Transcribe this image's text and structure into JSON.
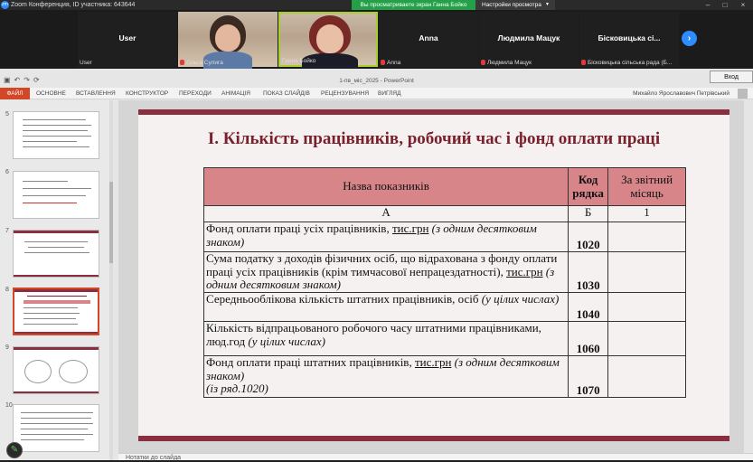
{
  "zoom": {
    "title": "Zoom Конференция, ID участника: 643644",
    "share_banner": "Вы просматриваете экран Ганна Бойко",
    "view_settings": "Настройки просмотра",
    "video_label": "Вход"
  },
  "participants": [
    {
      "center": "User",
      "bottom": "User",
      "video": false,
      "muted": false
    },
    {
      "center": "",
      "bottom": "Ольга Сулига",
      "video": true,
      "muted": true
    },
    {
      "center": "",
      "bottom": "Ганна Бойко",
      "video": true,
      "muted": false
    },
    {
      "center": "Anna",
      "bottom": "Anna",
      "video": false,
      "muted": true
    },
    {
      "center": "Людмила Мацук",
      "bottom": "Людмила Мацук",
      "video": false,
      "muted": true
    },
    {
      "center": "Бісковицька сі...",
      "bottom": "Бісковицька сільська рада (Б...",
      "video": false,
      "muted": true
    }
  ],
  "ppt": {
    "doc_title": "1-пв_міс_2025 - PowerPoint",
    "tabs": [
      "ФАЙЛ",
      "ОСНОВНЕ",
      "ВСТАВЛЕННЯ",
      "КОНСТРУКТОР",
      "ПЕРЕХОДИ",
      "АНІМАЦІЯ",
      "ПОКАЗ СЛАЙДІВ",
      "РЕЦЕНЗУВАННЯ",
      "ВИГЛЯД"
    ],
    "user": "Михайло Ярославович Петрівський",
    "thumb_numbers": [
      "5",
      "6",
      "7",
      "8",
      "9",
      "10"
    ],
    "notes": "Нотатки до слайда"
  },
  "slide": {
    "title": "І. Кількість працівників, робочий час і фонд оплати праці",
    "headers": [
      "Назва показників",
      "Код рядка",
      "За звітний місяць"
    ],
    "letters": [
      "А",
      "Б",
      "1"
    ],
    "rows": [
      {
        "pre": "Фонд оплати праці усіх працівників, ",
        "u": "тис.грн",
        "post": " ",
        "italic": "(з одним десятковим знаком)",
        "code": "1020",
        "value": ""
      },
      {
        "pre": "Сума податку з доходів фізичних осіб, що відрахована з фонду оплати праці усіх працівників (крім тимчасової непрацездатності), ",
        "u": "тис.грн",
        "post": " ",
        "italic": "(з одним десятковим знаком)",
        "code": "1030",
        "value": ""
      },
      {
        "pre": "Середньооблікова кількість штатних працівників, осіб ",
        "u": "",
        "post": "",
        "italic": "(у цілих числах)",
        "code": "1040",
        "value": ""
      },
      {
        "pre": "Кількість відпрацьованого робочого часу штатними працівниками, люд.год ",
        "u": "",
        "post": "",
        "italic": "(у цілих числах)",
        "code": "1060",
        "value": ""
      },
      {
        "pre": "Фонд оплати праці штатних працівників, ",
        "u": "тис.грн",
        "post": " ",
        "italic": "(з одним десятковим знаком)",
        "extra": "(із ряд.1020)",
        "code": "1070",
        "value": ""
      }
    ]
  }
}
